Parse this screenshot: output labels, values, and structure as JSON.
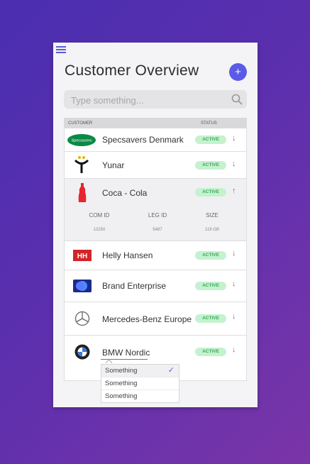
{
  "header": {
    "title": "Customer Overview",
    "add_label": "+"
  },
  "search": {
    "placeholder": "Type something..."
  },
  "table": {
    "columns": {
      "customer": "CUSTOMER",
      "status": "STATUS"
    },
    "rows": [
      {
        "name": "Specsavers Denmark",
        "status": "ACTIVE",
        "logo": "specsavers-logo",
        "logo_text": "Specsavers"
      },
      {
        "name": "Yunar",
        "status": "ACTIVE",
        "logo": "yunar-logo"
      },
      {
        "name": "Coca - Cola",
        "status": "ACTIVE",
        "logo": "coca-cola-bottle-logo"
      },
      {
        "name": "Helly Hansen",
        "status": "ACTIVE",
        "logo": "helly-hansen-logo",
        "logo_text": "HH"
      },
      {
        "name": "Brand Enterprise",
        "status": "ACTIVE",
        "logo": "brand-enterprise-logo"
      },
      {
        "name": "Mercedes-Benz Europe",
        "status": "ACTIVE",
        "logo": "mercedes-logo"
      },
      {
        "name": "BMW Nordic",
        "status": "ACTIVE",
        "logo": "bmw-logo"
      }
    ],
    "expanded_details": {
      "com_id_label": "COM ID",
      "com_id_value": "13250",
      "leg_id_label": "LEG ID",
      "leg_id_value": "5487",
      "size_label": "SIZE",
      "size_value": "119 GB"
    }
  },
  "dropdown": {
    "options": [
      "Something",
      "Something",
      "Something"
    ],
    "selected_index": 0
  },
  "colors": {
    "accent": "#5a5be6",
    "badge_bg": "#c4f2cf",
    "badge_text": "#3da85a"
  }
}
